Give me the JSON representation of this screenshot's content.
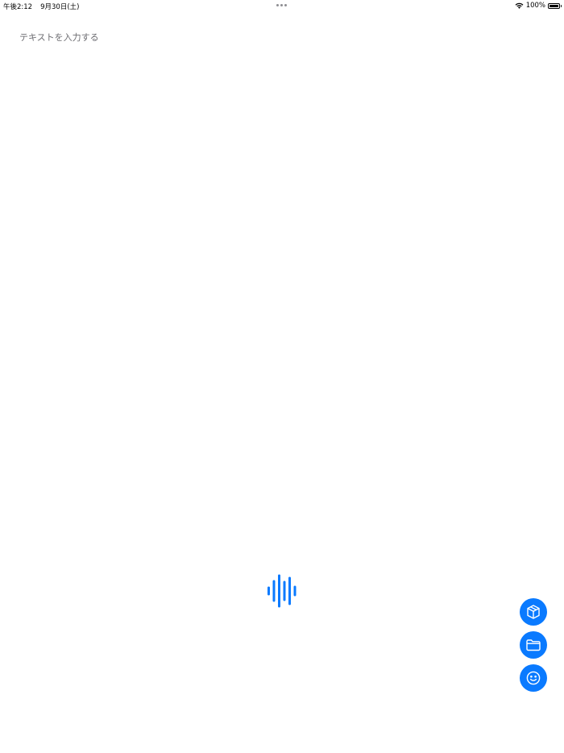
{
  "status_bar": {
    "time": "午後2:12",
    "date": "9月30日(土)",
    "battery_percent": "100%",
    "battery_level": 1.0,
    "wifi_icon": "wifi-icon",
    "battery_icon": "battery-icon"
  },
  "editor": {
    "placeholder": "テキストを入力する",
    "value": ""
  },
  "toolbar": {
    "mic_icon": "waveform-icon",
    "actions": [
      {
        "icon": "cube-icon"
      },
      {
        "icon": "folder-icon"
      },
      {
        "icon": "smiley-icon"
      }
    ]
  },
  "colors": {
    "accent": "#0a7aff",
    "placeholder": "#6d6d72",
    "background": "#ffffff"
  }
}
